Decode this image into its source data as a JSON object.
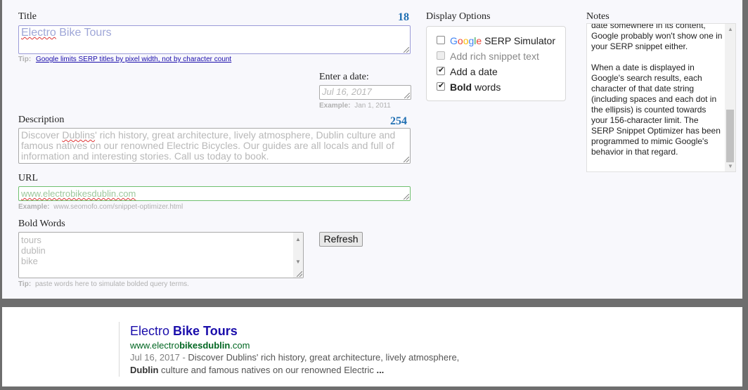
{
  "form": {
    "title_label": "Title",
    "title_count": "18",
    "title_value_a": "Electro",
    "title_value_b": " Bike Tours",
    "title_tip_prefix": "Tip:",
    "title_tip_link": "Google limits SERP titles by pixel width, not by character count",
    "date_label": "Enter a date:",
    "date_value": "Jul 16, 2017",
    "date_example_prefix": "Example:",
    "date_example": "Jan 1, 2011",
    "description_label": "Description",
    "description_count": "254",
    "description_value_a": "Discover ",
    "description_value_b": "Dublins",
    "description_value_c": "' rich history, great architecture, lively atmosphere, Dublin culture and famous natives on our renowned Electric Bicycles. Our guides are all locals and full of information and interesting stories. Call us today to book.",
    "url_label": "URL",
    "url_value": "www.electrobikesdublin.com",
    "url_example_prefix": "Example:",
    "url_example": "www.seomofo.com/snippet-optimizer.html",
    "bold_label": "Bold Words",
    "bold_words": [
      "tours",
      "dublin",
      "bike"
    ],
    "bold_tip_prefix": "Tip:",
    "bold_tip": "paste words here to simulate bolded query terms.",
    "refresh_label": "Refresh"
  },
  "display_options": {
    "label": "Display Options",
    "items": [
      {
        "label": "SERP Simulator",
        "brand": [
          "G",
          "o",
          "o",
          "g",
          "l",
          "e"
        ],
        "checked": false,
        "disabled": false
      },
      {
        "label": "Add rich snippet text",
        "checked": false,
        "disabled": true
      },
      {
        "label": "Add a date",
        "checked": true,
        "disabled": false
      },
      {
        "label_bold": "Bold",
        "label": " words",
        "checked": true,
        "disabled": false
      }
    ]
  },
  "notes": {
    "label": "Notes",
    "text": "date somewhere in its content, Google probably won't show one in your SERP snippet either.\n\nWhen a date is displayed in Google's search results, each character of that date string (including spaces and each dot in the ellipsis) is counted towards your 156-character limit. The SERP Snippet Optimizer has been programmed to mimic Google's behavior in that regard."
  },
  "preview": {
    "title_a": "Electro ",
    "title_b": "Bike Tours",
    "url_a": "www.electro",
    "url_b": "bikesdublin",
    "url_c": ".com",
    "date": "Jul 16, 2017 -",
    "desc_a": " Discover Dublins' rich history, great architecture, lively atmosphere,",
    "desc_b": "Dublin",
    "desc_c": " culture and famous natives on our renowned Electric ",
    "desc_d": "..."
  },
  "colors": {
    "link": "#1a0dab",
    "url": "#006621",
    "count": "#1f6fb2"
  }
}
